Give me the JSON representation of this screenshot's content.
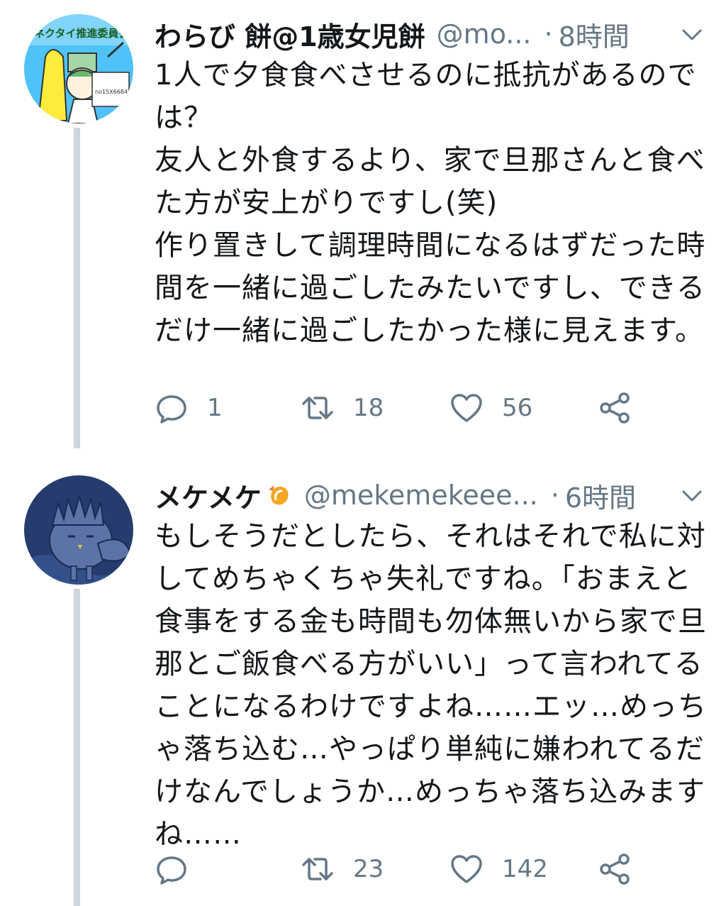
{
  "tweets": [
    {
      "name": "わらび 餅@1歳女児餅",
      "handle": "@mo...",
      "separator": "·",
      "time": "8時間",
      "avatar_text": "ネクタイ推進委員会",
      "avatar_sub": "no15X6684",
      "body": "1人で夕食食べさせるのに抵抗があるのでは？\n友人と外食するより、家で旦那さんと食べた方が安上がりですし(笑)\n作り置きして調理時間になるはずだった時間を一緒に過ごしたみたいですし、できるだけ一緒に過ごしたかった様に見えます。",
      "replies": "1",
      "retweets": "18",
      "likes": "56"
    },
    {
      "name": "メケメケ",
      "handle": "@mekemekeee...",
      "separator": "·",
      "time": "6時間",
      "emoji_icon": "shrimp-icon",
      "body": "もしそうだとしたら、それはそれで私に対してめちゃくちゃ失礼ですね。「おまえと食事をする金も時間も勿体無いから家で旦那とご飯食べる方がいい」って言われてることになるわけですよね……エッ…めっちゃ落ち込む…やっぱり単純に嫌われてるだけなんでしょうか…めっちゃ落ち込みますね……",
      "replies": "",
      "retweets": "23",
      "likes": "142"
    }
  ],
  "colors": {
    "text": "#14171a",
    "secondary": "#657786",
    "thread_line": "#ccd6dd",
    "background": "#ffffff"
  }
}
